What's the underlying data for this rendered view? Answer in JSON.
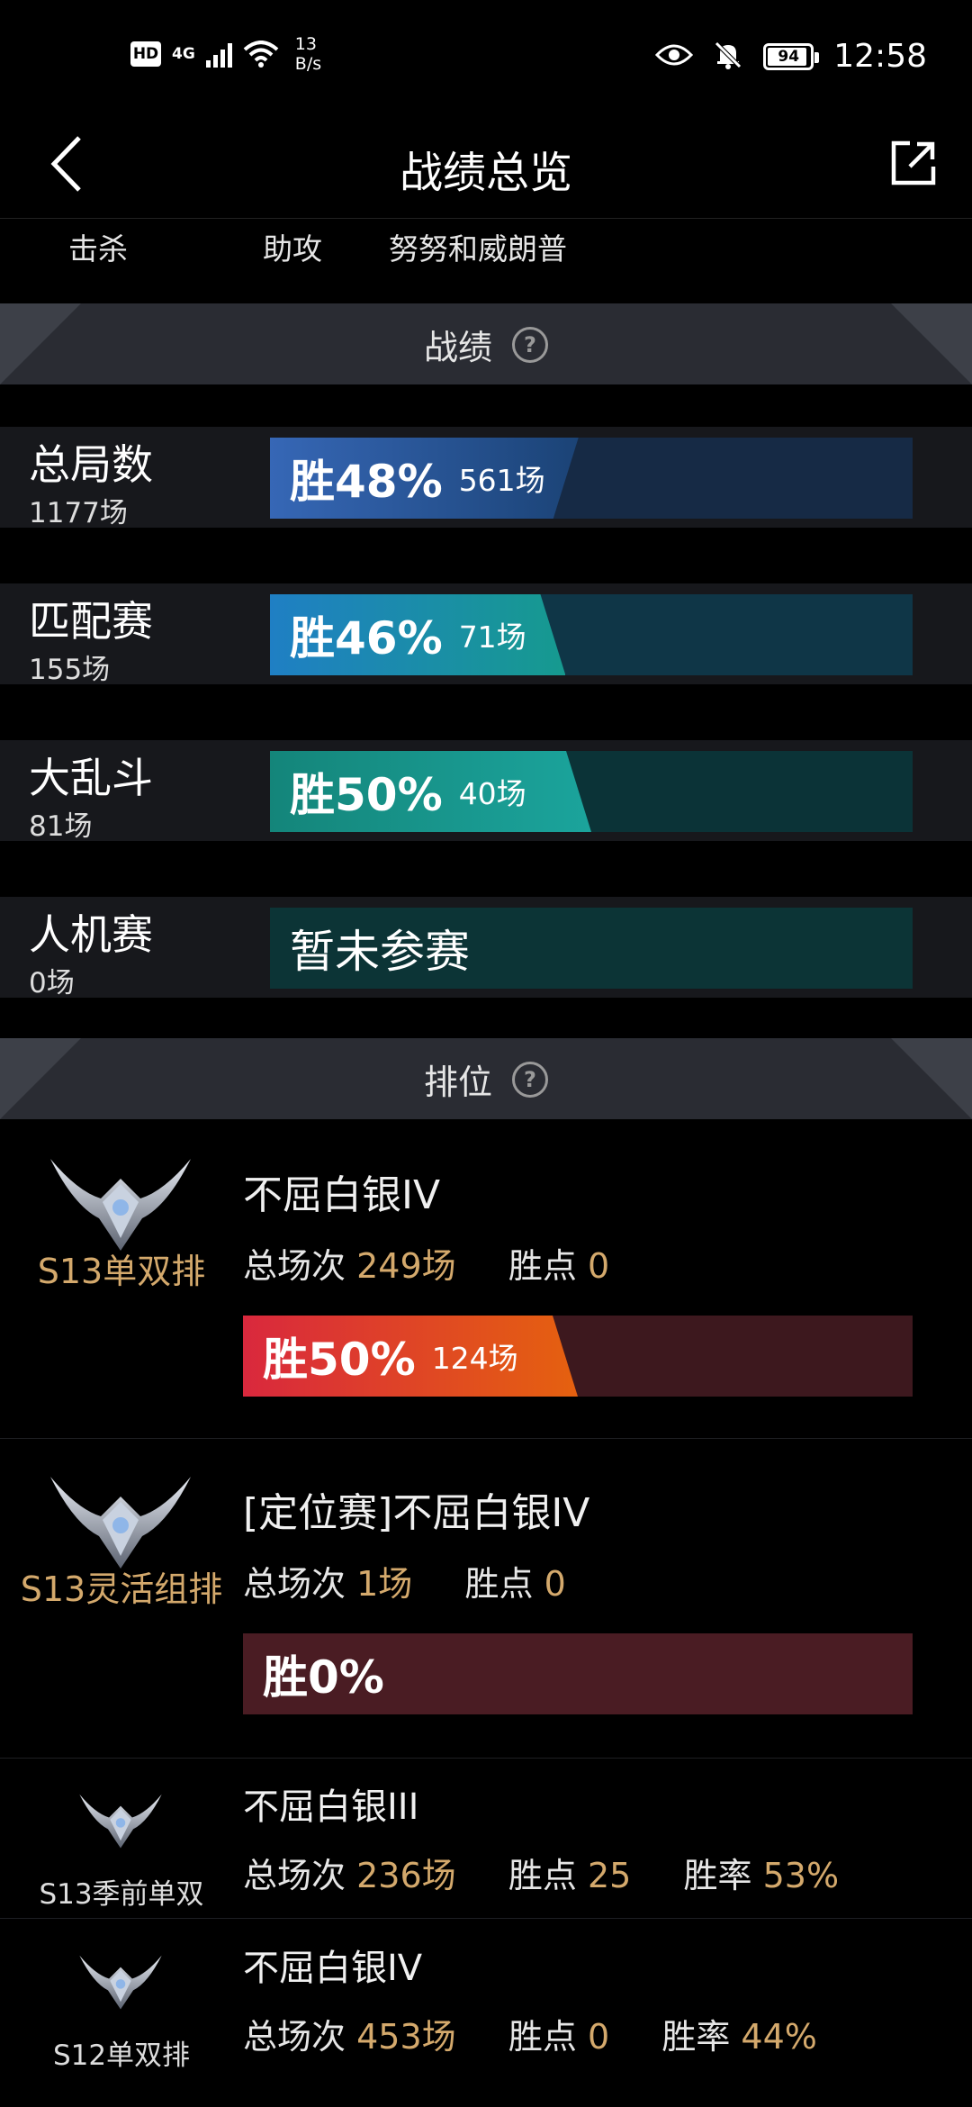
{
  "status_bar": {
    "hd": "HD",
    "network": "4G",
    "speed_value": "13",
    "speed_unit": "B/s",
    "battery": "94",
    "time": "12:58"
  },
  "header": {
    "title": "战绩总览"
  },
  "subtabs": [
    "击杀",
    "助攻",
    "努努和威朗普"
  ],
  "record_section": {
    "title": "战绩",
    "rows": [
      {
        "name": "总局数",
        "count": "1177场",
        "win_pct": "胜48%",
        "wins": "561场",
        "win_rate": 0.48
      },
      {
        "name": "匹配赛",
        "count": "155场",
        "win_pct": "胜46%",
        "wins": "71场",
        "win_rate": 0.46
      },
      {
        "name": "大乱斗",
        "count": "81场",
        "win_pct": "胜50%",
        "wins": "40场",
        "win_rate": 0.5
      },
      {
        "name": "人机赛",
        "count": "0场",
        "empty_text": "暂未参赛"
      }
    ]
  },
  "ranked_section": {
    "title": "排位",
    "entries": [
      {
        "season": "S13单双排",
        "rank": "不屈白银IV",
        "total_label": "总场次",
        "total": "249场",
        "points_label": "胜点",
        "points": "0",
        "win_pct": "胜50%",
        "wins": "124场",
        "win_rate": 0.5
      },
      {
        "season": "S13灵活组排",
        "rank": "[定位赛]不屈白银IV",
        "total_label": "总场次",
        "total": "1场",
        "points_label": "胜点",
        "points": "0",
        "win_pct": "胜0%",
        "win_rate": 0.0
      },
      {
        "season": "S13季前单双",
        "rank": "不屈白银III",
        "total_label": "总场次",
        "total": "236场",
        "points_label": "胜点",
        "points": "25",
        "rate_label": "胜率",
        "rate": "53%"
      },
      {
        "season": "S12单双排",
        "rank": "不屈白银IV",
        "total_label": "总场次",
        "total": "453场",
        "points_label": "胜点",
        "points": "0",
        "rate_label": "胜率",
        "rate": "44%"
      }
    ]
  },
  "icons": {
    "back": "chevron-left-icon",
    "share": "share-external-icon",
    "help": "question-circle-icon",
    "emblem": "silver-rank-emblem"
  },
  "colors": {
    "gold_text": "#d4a96c",
    "section_bg": "#2a2c33",
    "row_bg": "#17181c"
  }
}
